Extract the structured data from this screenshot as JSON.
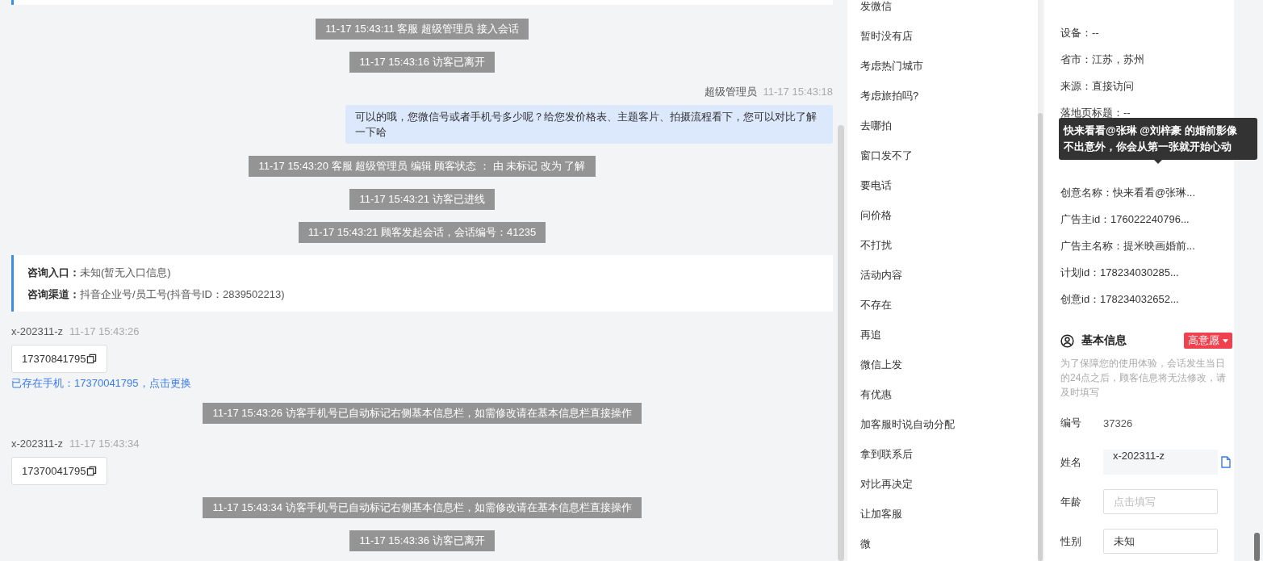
{
  "chat": {
    "messages": [
      {
        "kind": "system",
        "text": "11-17 15:43:11 客服 超级管理员 接入会话"
      },
      {
        "kind": "system",
        "text": "11-17 15:43:16 访客已离开"
      },
      {
        "kind": "agent",
        "sender": "超级管理员",
        "time": "11-17 15:43:18",
        "text": "可以的哦，您微信号或者手机号多少呢？给您发价格表、主题客片、拍摄流程看下，您可以对比了解一下哈"
      },
      {
        "kind": "system",
        "text": "11-17 15:43:20 客服 超级管理员 编辑 顾客状态 ： 由 未标记 改为 了解"
      },
      {
        "kind": "system",
        "text": "11-17 15:43:21 访客已进线"
      },
      {
        "kind": "system",
        "text": "11-17 15:43:21 顾客发起会话，会话编号：41235"
      },
      {
        "kind": "entry",
        "rows": [
          {
            "label": "咨询入口：",
            "value": "未知(暂无入口信息)"
          },
          {
            "label": "咨询渠道：",
            "value": "抖音企业号/员工号(抖音号ID：2839502213)"
          }
        ]
      },
      {
        "kind": "visitor",
        "sender": "x-202311-z",
        "time": "11-17 15:43:26",
        "phone": "17370841795",
        "note": "已存在手机：17370041795，点击更换"
      },
      {
        "kind": "system",
        "text": "11-17 15:43:26 访客手机号已自动标记右侧基本信息栏，如需修改请在基本信息栏直接操作"
      },
      {
        "kind": "visitor",
        "sender": "x-202311-z",
        "time": "11-17 15:43:34",
        "phone": "17370041795"
      },
      {
        "kind": "system",
        "text": "11-17 15:43:34 访客手机号已自动标记右侧基本信息栏，如需修改请在基本信息栏直接操作"
      },
      {
        "kind": "system",
        "text": "11-17 15:43:36 访客已离开"
      }
    ]
  },
  "quick_replies": [
    "发微信",
    "暂时没有店",
    "考虑热门城市",
    "考虑旅拍吗?",
    "去哪拍",
    "窗口发不了",
    "要电话",
    "问价格",
    "不打扰",
    "活动内容",
    "不存在",
    "再追",
    "微信上发",
    "有优惠",
    "加客服时说自动分配",
    "拿到联系后",
    "对比再决定",
    "让加客服",
    "微"
  ],
  "visitor_info": {
    "rows_before": [
      "设备：--",
      "省市：江苏，苏州",
      "来源：直接访问",
      "落地页标题：--"
    ],
    "tooltip": {
      "lines": [
        "快来看看@张琳 @刘梓豪 的婚前影像",
        "不出意外，你会从第一张就开始心动"
      ]
    },
    "rows_after": [
      "创意名称：快来看看@张琳...",
      "广告主id：176022240796...",
      "广告主名称：提米映画婚前...",
      "计划id：178234030285...",
      "创意id：178234032652..."
    ]
  },
  "basic_info": {
    "title": "基本信息",
    "tag": "高意愿",
    "note": "为了保障您的使用体验，会话发生当日的24点之后，顾客信息将无法修改，请及时填写",
    "fields": [
      {
        "label": "编号",
        "kind": "text",
        "value": "37326",
        "copyable": false
      },
      {
        "label": "姓名",
        "kind": "readonly",
        "value": "x-202311-z",
        "copyable": true
      },
      {
        "label": "年龄",
        "kind": "input",
        "placeholder": "点击填写",
        "copyable": false
      },
      {
        "label": "性别",
        "kind": "input",
        "value": "未知",
        "copyable": false
      }
    ]
  }
}
